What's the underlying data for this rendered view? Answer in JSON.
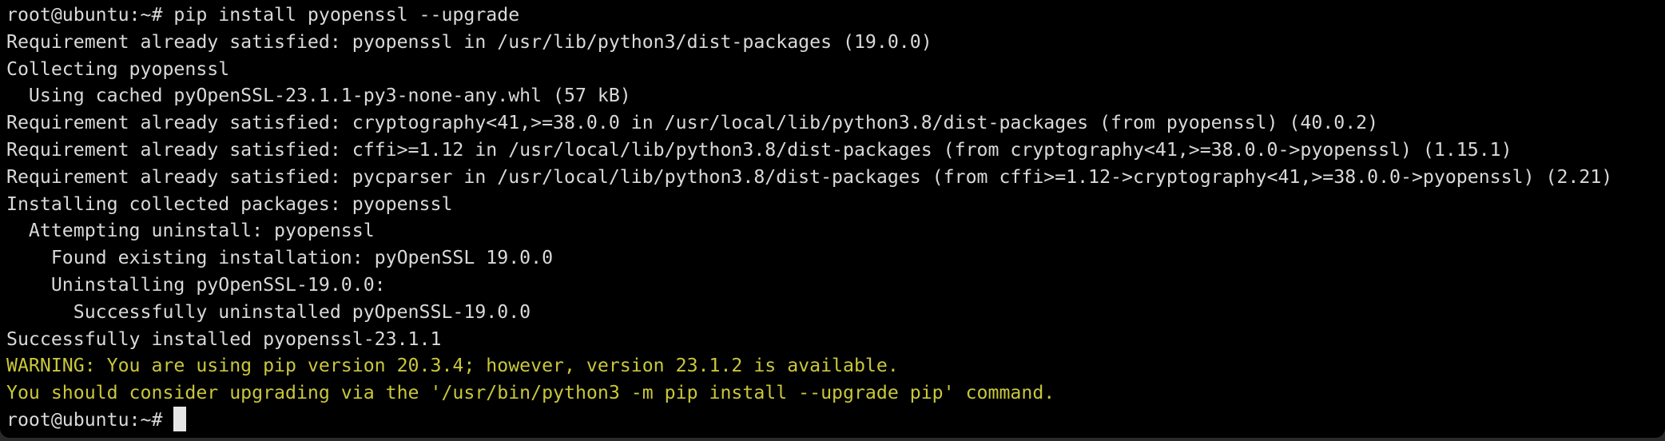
{
  "terminal": {
    "prompt": "root@ubuntu:~#",
    "colors": {
      "background": "#000000",
      "text": "#d9d9d9",
      "warning": "#c9c73a",
      "cursor": "#e6e6e6"
    },
    "lines": [
      {
        "text": "root@ubuntu:~# pip install pyopenssl --upgrade",
        "type": "command"
      },
      {
        "text": "Requirement already satisfied: pyopenssl in /usr/lib/python3/dist-packages (19.0.0)",
        "type": "output"
      },
      {
        "text": "Collecting pyopenssl",
        "type": "output"
      },
      {
        "text": "  Using cached pyOpenSSL-23.1.1-py3-none-any.whl (57 kB)",
        "type": "output"
      },
      {
        "text": "Requirement already satisfied: cryptography<41,>=38.0.0 in /usr/local/lib/python3.8/dist-packages (from pyopenssl) (40.0.2)",
        "type": "output"
      },
      {
        "text": "Requirement already satisfied: cffi>=1.12 in /usr/local/lib/python3.8/dist-packages (from cryptography<41,>=38.0.0->pyopenssl) (1.15.1)",
        "type": "output"
      },
      {
        "text": "Requirement already satisfied: pycparser in /usr/local/lib/python3.8/dist-packages (from cffi>=1.12->cryptography<41,>=38.0.0->pyopenssl) (2.21)",
        "type": "output"
      },
      {
        "text": "Installing collected packages: pyopenssl",
        "type": "output"
      },
      {
        "text": "  Attempting uninstall: pyopenssl",
        "type": "output"
      },
      {
        "text": "    Found existing installation: pyOpenSSL 19.0.0",
        "type": "output"
      },
      {
        "text": "    Uninstalling pyOpenSSL-19.0.0:",
        "type": "output"
      },
      {
        "text": "      Successfully uninstalled pyOpenSSL-19.0.0",
        "type": "output"
      },
      {
        "text": "Successfully installed pyopenssl-23.1.1",
        "type": "output"
      },
      {
        "text": "WARNING: You are using pip version 20.3.4; however, version 23.1.2 is available.",
        "type": "warning"
      },
      {
        "text": "You should consider upgrading via the '/usr/bin/python3 -m pip install --upgrade pip' command.",
        "type": "warning"
      }
    ]
  }
}
